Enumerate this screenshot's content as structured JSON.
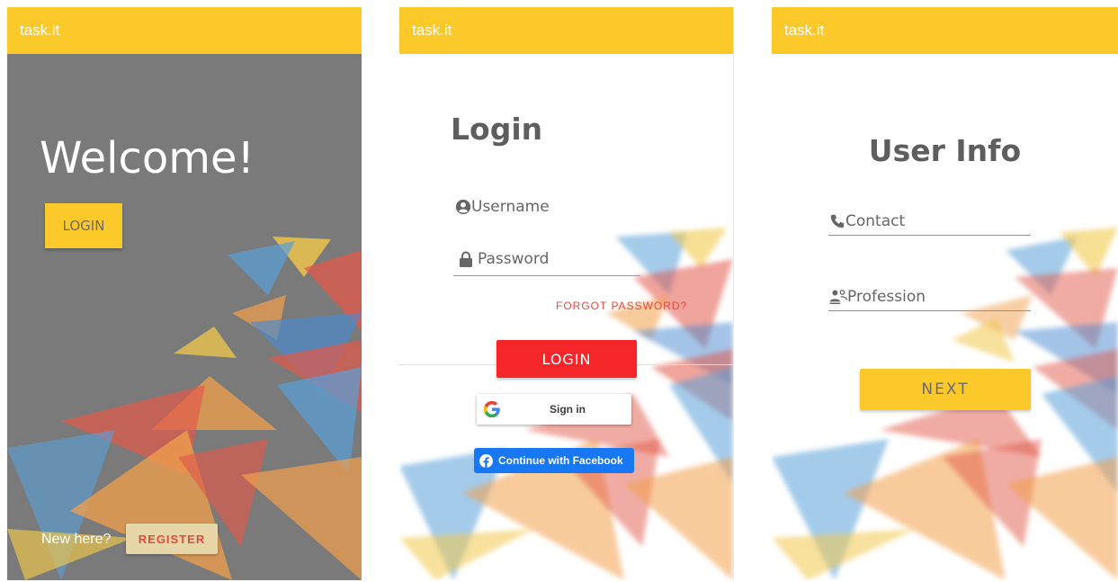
{
  "app_title": "task.it",
  "welcome_screen": {
    "heading": "Welcome!",
    "login_label": "LOGIN",
    "new_here_text": "New here?",
    "register_label": "REGISTER"
  },
  "login_screen": {
    "heading": "Login",
    "username_label": "Username",
    "password_label": "Password",
    "forgot_password_label": "FORGOT PASSWORD?",
    "login_label": "LOGIN",
    "google_signin_label": "Sign in",
    "facebook_label": "Continue with Facebook"
  },
  "user_info_screen": {
    "heading": "User Info",
    "contact_label": "Contact",
    "profession_label": "Profession",
    "next_label": "NEXT"
  },
  "colors": {
    "appbar": "#fcc92b",
    "welcome_background": "#7a7a7a",
    "login_button": "#f5262a",
    "facebook": "#1877f2",
    "accent_text": "#e24b3f"
  },
  "icons": [
    "user-circle-icon",
    "lock-icon",
    "phone-icon",
    "users-icon",
    "google-logo-icon",
    "facebook-logo-icon"
  ]
}
